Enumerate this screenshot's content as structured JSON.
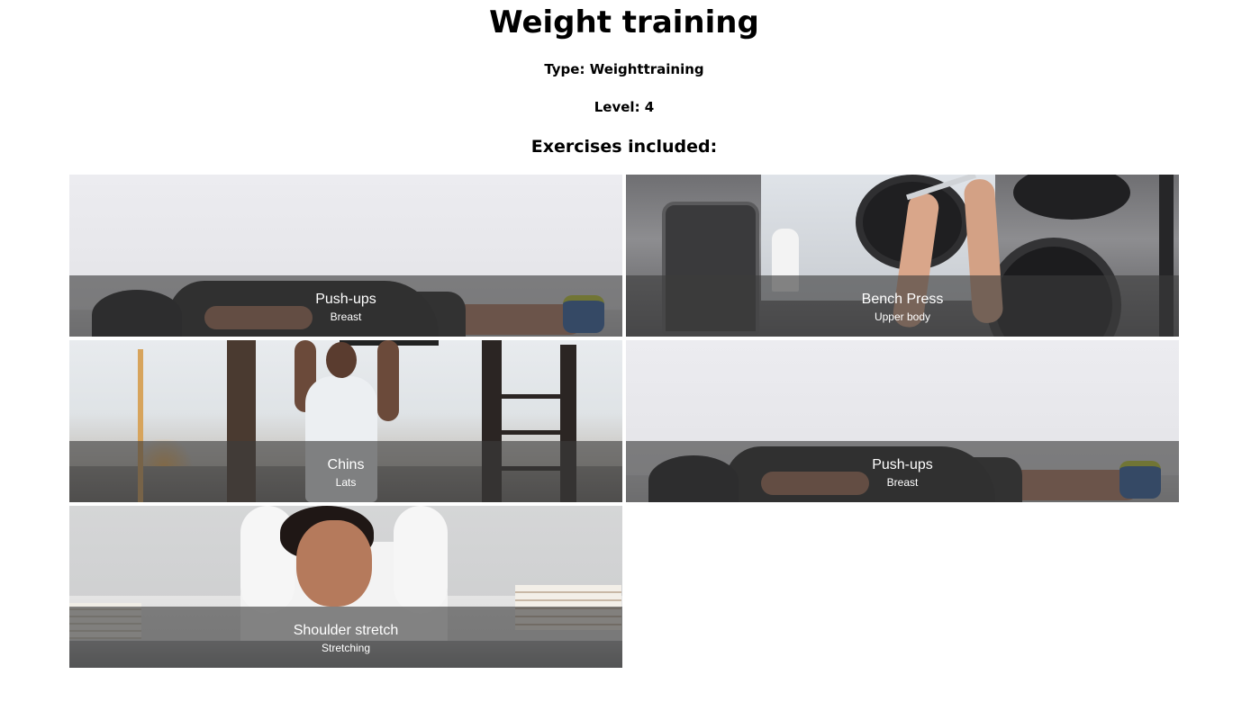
{
  "page": {
    "title": "Weight training",
    "type_line": "Type: Weighttraining",
    "level_line": "Level: 4",
    "exercises_heading": "Exercises included:"
  },
  "exercises": [
    {
      "name": "Push-ups",
      "category": "Breast"
    },
    {
      "name": "Bench Press",
      "category": "Upper body"
    },
    {
      "name": "Chins",
      "category": "Lats"
    },
    {
      "name": "Push-ups",
      "category": "Breast"
    },
    {
      "name": "Shoulder stretch",
      "category": "Stretching"
    }
  ]
}
